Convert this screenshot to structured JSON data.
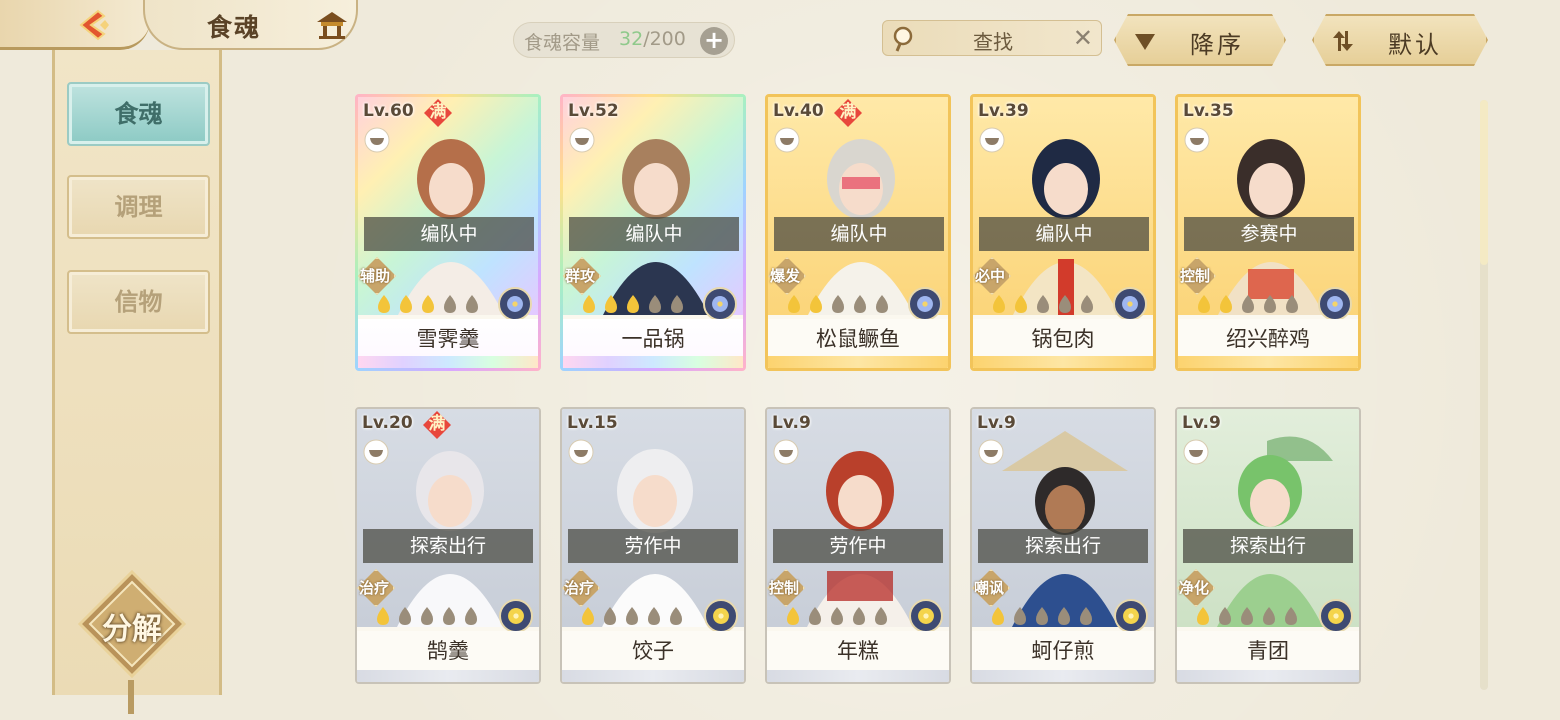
{
  "header": {
    "title": "食魂",
    "capacity_label": "食魂容量",
    "capacity_current": "32",
    "capacity_total": "/200",
    "search_placeholder": "查找",
    "sort_label": "降序",
    "default_label": "默认"
  },
  "sidebar": {
    "tabs": [
      {
        "label": "食魂",
        "active": true
      },
      {
        "label": "调理",
        "active": false
      },
      {
        "label": "信物",
        "active": false
      }
    ],
    "decompose_label": "分解"
  },
  "cards": [
    {
      "level": "Lv.60",
      "max": "满",
      "status": "编队中",
      "role": "辅助",
      "name": "雪霁羹",
      "flames_lit": 3,
      "flames_total": 5,
      "rarity": "rainbow",
      "element": "blue-flower"
    },
    {
      "level": "Lv.52",
      "max": "",
      "status": "编队中",
      "role": "群攻",
      "name": "一品锅",
      "flames_lit": 3,
      "flames_total": 5,
      "rarity": "rainbow",
      "element": "blue-flower"
    },
    {
      "level": "Lv.40",
      "max": "满",
      "status": "编队中",
      "role": "爆发",
      "name": "松鼠鳜鱼",
      "flames_lit": 2,
      "flames_total": 5,
      "rarity": "gold",
      "element": "blue-flower"
    },
    {
      "level": "Lv.39",
      "max": "",
      "status": "编队中",
      "role": "必中",
      "name": "锅包肉",
      "flames_lit": 2,
      "flames_total": 5,
      "rarity": "gold",
      "element": "blue-flower"
    },
    {
      "level": "Lv.35",
      "max": "",
      "status": "参赛中",
      "role": "控制",
      "name": "绍兴醉鸡",
      "flames_lit": 2,
      "flames_total": 5,
      "rarity": "gold",
      "element": "blue-flower"
    },
    {
      "level": "Lv.20",
      "max": "满",
      "status": "探索出行",
      "role": "治疗",
      "name": "鹄羹",
      "flames_lit": 1,
      "flames_total": 5,
      "rarity": "silver",
      "element": "yellow-flower"
    },
    {
      "level": "Lv.15",
      "max": "",
      "status": "劳作中",
      "role": "治疗",
      "name": "饺子",
      "flames_lit": 1,
      "flames_total": 5,
      "rarity": "silver",
      "element": "yellow-flower"
    },
    {
      "level": "Lv.9",
      "max": "",
      "status": "劳作中",
      "role": "控制",
      "name": "年糕",
      "flames_lit": 1,
      "flames_total": 5,
      "rarity": "silver",
      "element": "yellow-flower"
    },
    {
      "level": "Lv.9",
      "max": "",
      "status": "探索出行",
      "role": "嘲讽",
      "name": "蚵仔煎",
      "flames_lit": 1,
      "flames_total": 5,
      "rarity": "silver",
      "element": "yellow-flower"
    },
    {
      "level": "Lv.9",
      "max": "",
      "status": "探索出行",
      "role": "净化",
      "name": "青团",
      "flames_lit": 1,
      "flames_total": 5,
      "rarity": "silver",
      "element": "yellow-flower"
    }
  ],
  "colors": {
    "accent_teal": "#8ccac4",
    "gold": "#f2c45a",
    "max_badge_red": "#e8473c",
    "capacity_green": "#8fc98b"
  }
}
